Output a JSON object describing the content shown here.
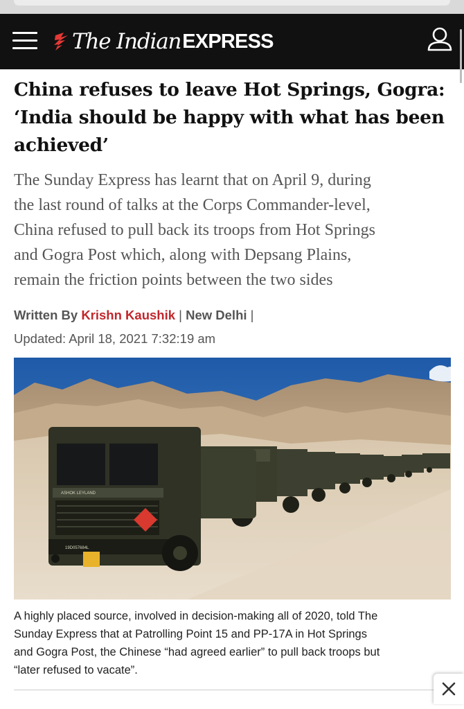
{
  "site": {
    "logo_the": "The Indian",
    "logo_express": "EXPRESS",
    "icons": {
      "menu": "hamburger-menu-icon",
      "user": "user-account-icon",
      "logo_mark": "flame-logo-icon",
      "close": "close-icon"
    },
    "colors": {
      "masthead_bg": "#111111",
      "logo_mark": "#e53935",
      "author_link": "#c1272d"
    }
  },
  "article": {
    "headline_lines": [
      "China refuses to leave Hot Springs, Gogra:",
      "‘India should be happy with what has been",
      "achieved’"
    ],
    "standfirst_lines": [
      "The Sunday Express has learnt that on April 9, during",
      "the last round of talks at the Corps Commander-level,",
      "China refused to pull back its troops from Hot Springs",
      "and Gogra Post which, along with Depsang Plains,",
      "remain the friction points between the two sides"
    ],
    "byline": {
      "label": "Written By",
      "author": "Krishn Kaushik",
      "sep1": "|",
      "city": "New Delhi",
      "sep2": "|",
      "updated": "Updated: April 18, 2021 7:32:19 am"
    },
    "caption_lines": [
      "A highly placed source, involved in decision-making all of 2020, told The",
      "Sunday Express that at Patrolling Point 15 and PP-17A in Hot Springs",
      "and Gogra Post, the Chinese “had agreed earlier” to pull back troops but",
      "“later refused to vacate”."
    ],
    "photo_text": {
      "truck_brand": "ASHOK LEYLAND",
      "plate": "19D057684L"
    }
  }
}
